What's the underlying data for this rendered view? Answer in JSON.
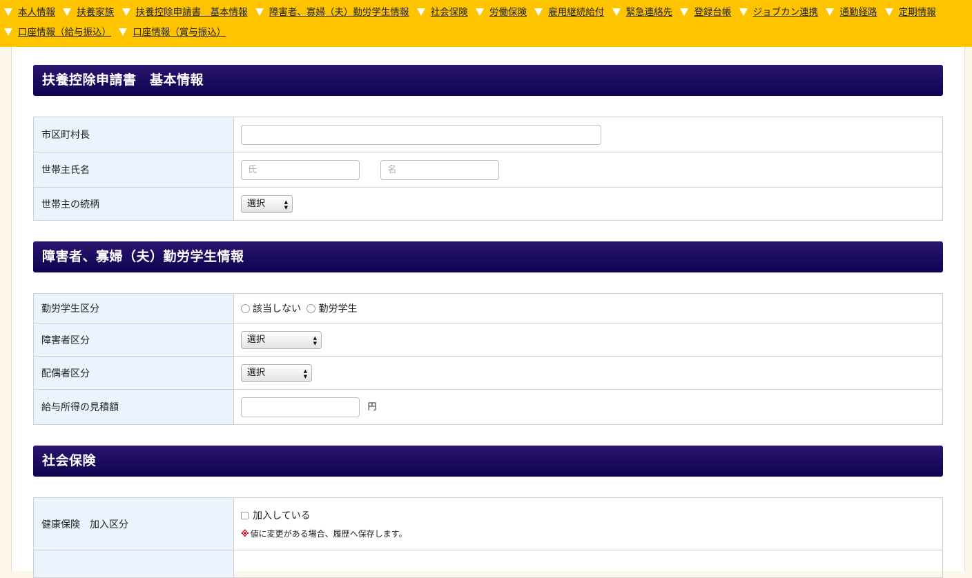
{
  "nav": {
    "items": [
      "本人情報",
      "扶養家族",
      "扶養控除申請書　基本情報",
      "障害者、寡婦（夫）勤労学生情報",
      "社会保険",
      "労働保険",
      "雇用継続給付",
      "緊急連絡先",
      "登録台帳",
      "ジョブカン連携",
      "通勤経路",
      "定期情報",
      "口座情報（給与振込）",
      "口座情報（賞与振込）"
    ]
  },
  "section1": {
    "title": "扶養控除申請書　基本情報",
    "mayor_label": "市区町村長",
    "mayor_value": "",
    "householder_label": "世帯主氏名",
    "last_name_placeholder": "氏",
    "first_name_placeholder": "名",
    "relation_label": "世帯主の続柄",
    "relation_value": "選択"
  },
  "section2": {
    "title": "障害者、寡婦（夫）勤労学生情報",
    "student_label": "勤労学生区分",
    "student_options": [
      "該当しない",
      "勤労学生"
    ],
    "disability_label": "障害者区分",
    "disability_value": "選択",
    "spouse_label": "配偶者区分",
    "spouse_value": "選択",
    "income_label": "給与所得の見積額",
    "income_value": "",
    "income_unit": "円"
  },
  "section3": {
    "title": "社会保険",
    "health_label": "健康保険　加入区分",
    "health_checkbox": "加入している",
    "note_mark": "※",
    "note_text": "値に変更がある場合、履歴へ保存します。"
  }
}
